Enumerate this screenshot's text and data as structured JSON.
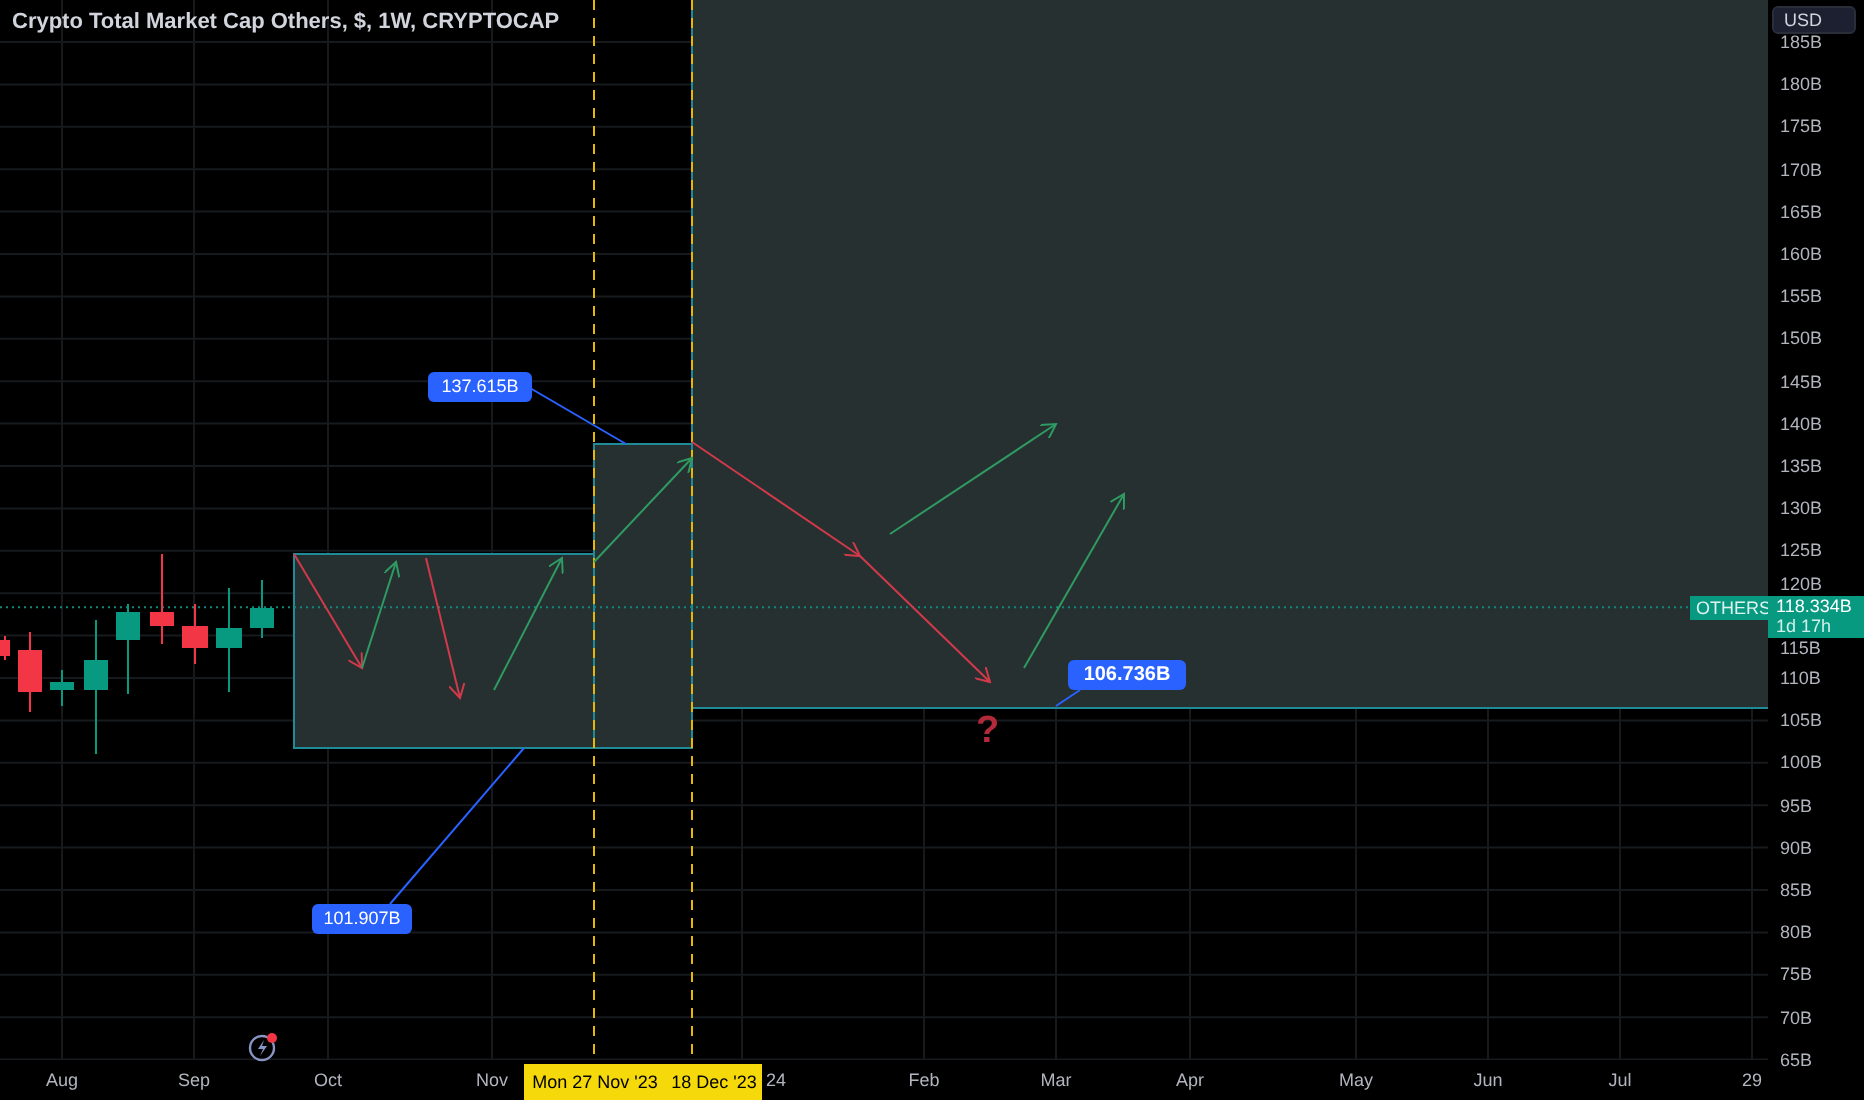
{
  "title": "Crypto Total Market Cap Others, $, 1W, CRYPTOCAP",
  "price_axis": {
    "currency": "USD",
    "ticks": [
      "185B",
      "180B",
      "175B",
      "170B",
      "165B",
      "160B",
      "155B",
      "150B",
      "145B",
      "140B",
      "135B",
      "130B",
      "125B",
      "120B",
      "115B",
      "110B",
      "105B",
      "100B",
      "95B",
      "90B",
      "85B",
      "80B",
      "75B",
      "70B",
      "65B"
    ]
  },
  "time_axis": [
    "Aug",
    "Sep",
    "Oct",
    "Nov",
    "24",
    "Feb",
    "Mar",
    "Apr",
    "May",
    "Jun",
    "Jul",
    "29"
  ],
  "crosshair_dates": [
    "Mon 27 Nov '23",
    "18 Dec '23"
  ],
  "last_price": {
    "symbol": "OTHERS",
    "price": "118.334B",
    "countdown": "1d 17h"
  },
  "callouts": [
    "137.615B",
    "101.907B",
    "106.736B"
  ],
  "note": "?"
}
